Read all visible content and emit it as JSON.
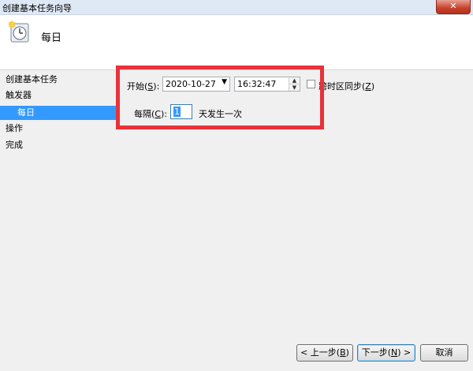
{
  "window": {
    "title": "创建基本任务向导",
    "close_label": "✕"
  },
  "header": {
    "page_title": "每日"
  },
  "nav": {
    "items": [
      {
        "label": "创建基本任务"
      },
      {
        "label": "触发器"
      },
      {
        "label": "每日"
      },
      {
        "label": "操作"
      },
      {
        "label": "完成"
      }
    ]
  },
  "trigger": {
    "start_label": "开始(",
    "start_hotkey": "S",
    "start_close": "):",
    "date_value": "2020-10-27",
    "time_value": "16:32:47",
    "sync_label_a": "跨时区同步(",
    "sync_hotkey": "Z",
    "sync_label_b": ")",
    "interval_label": "每隔(",
    "interval_hotkey": "C",
    "interval_close": "):",
    "interval_value": "1",
    "interval_suffix": "天发生一次"
  },
  "buttons": {
    "back_a": "< 上一步(",
    "back_hotkey": "B",
    "back_b": ")",
    "next_a": "下一步(",
    "next_hotkey": "N",
    "next_b": ") >",
    "cancel": "取消"
  }
}
